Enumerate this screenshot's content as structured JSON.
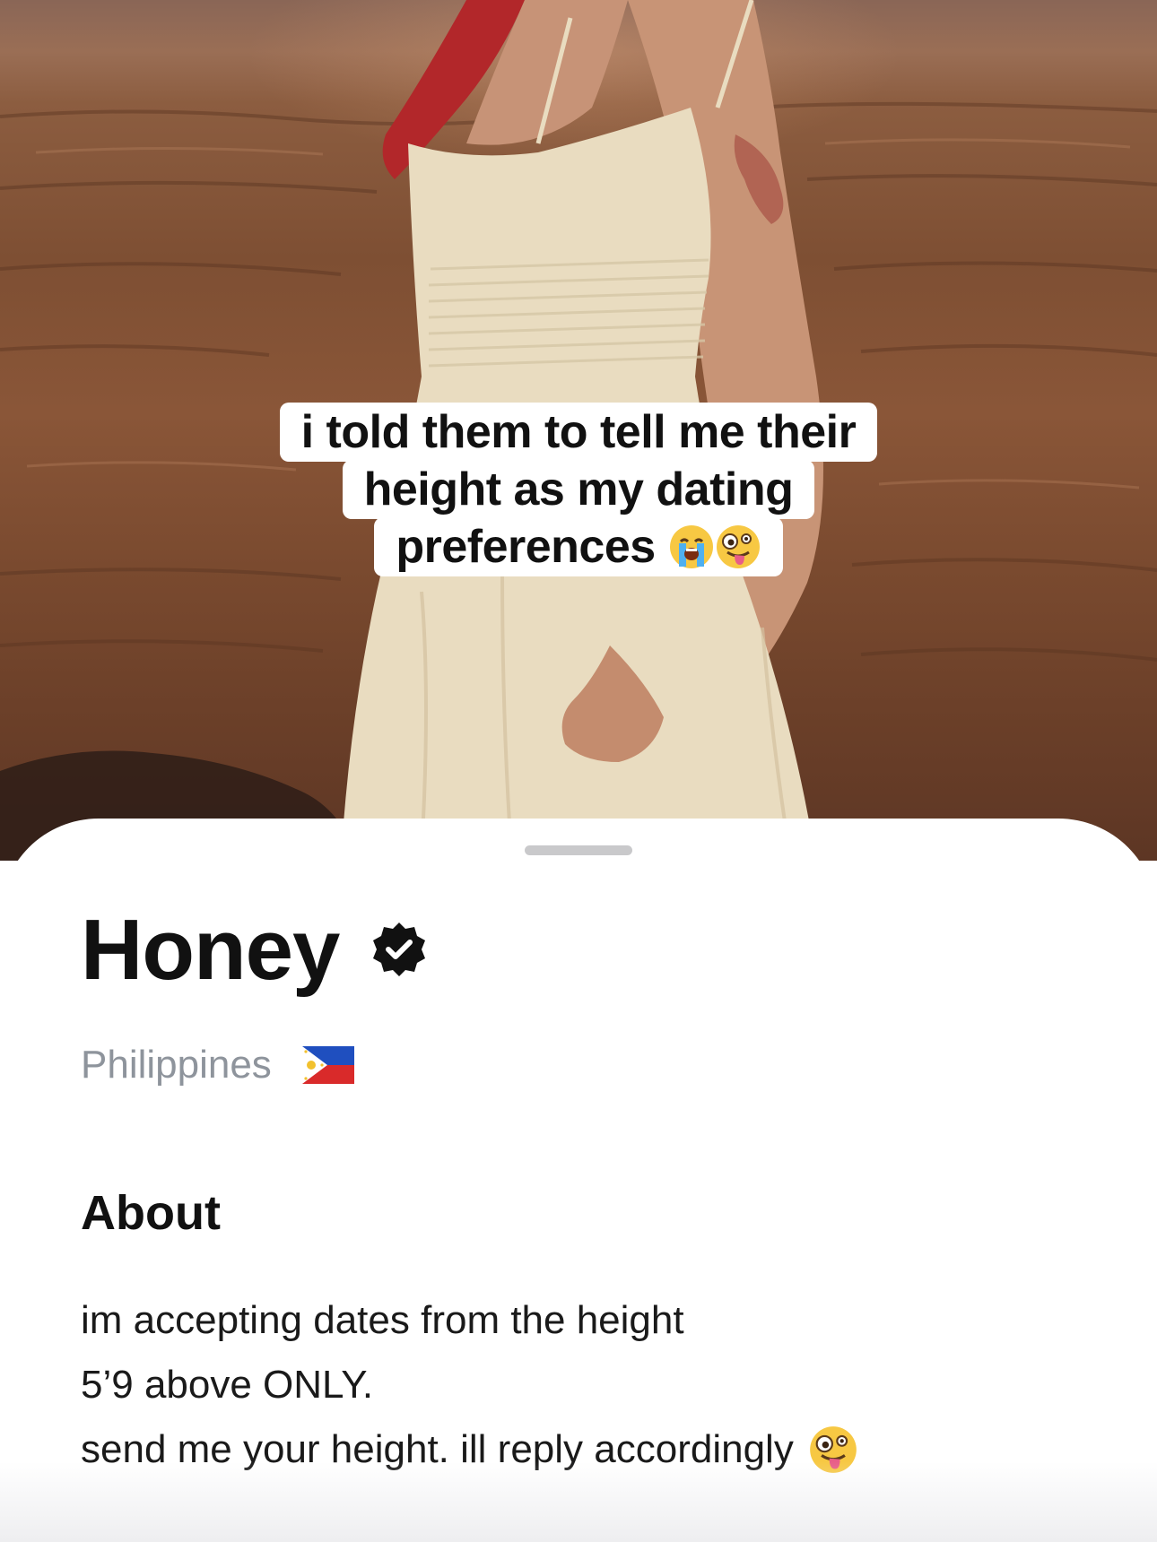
{
  "photo": {
    "icon": "profile-photo"
  },
  "caption": {
    "lines": [
      "i told them to tell me their",
      "height as my dating",
      "preferences"
    ],
    "emojis": [
      "loudly-crying-face-icon",
      "zany-face-icon"
    ]
  },
  "profile": {
    "name": "Honey",
    "verified_icon": "verified-badge-icon",
    "location": "Philippines",
    "flag_icon": "philippines-flag-icon"
  },
  "about": {
    "heading": "About",
    "lines": [
      "im accepting dates from the height",
      "5’9 above ONLY.",
      "send me your height. ill reply accordingly"
    ],
    "trailing_emoji": "zany-face-icon"
  },
  "colors": {
    "sheet": "#ffffff",
    "location_gray": "#8e949c",
    "verified_badge": "#111111"
  }
}
